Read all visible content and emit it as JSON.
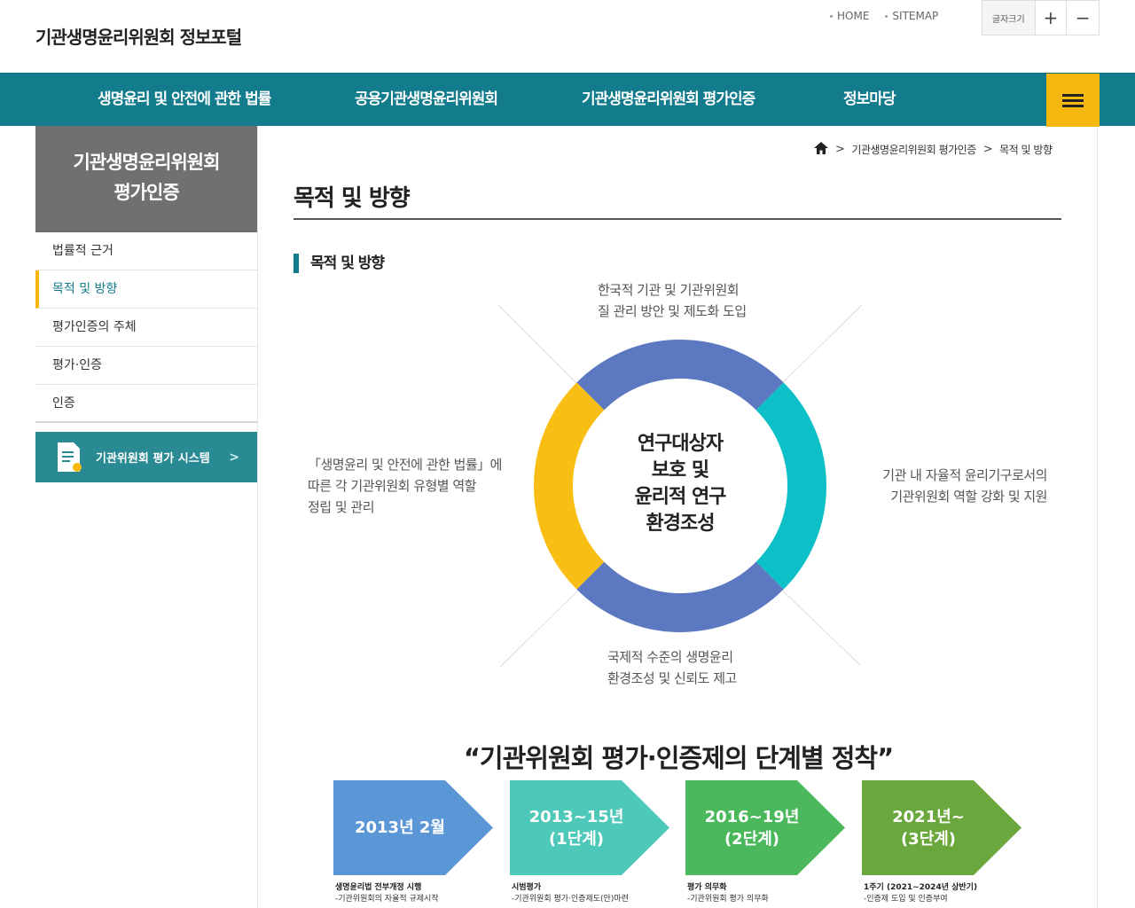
{
  "header": {
    "site_title": "기관생명윤리위원회 정보포털",
    "util_links": [
      "HOME",
      "SITEMAP"
    ],
    "font_size_label": "글자크기",
    "font_plus": "+",
    "font_minus": "−"
  },
  "gnb": {
    "items": [
      "생명윤리 및 안전에 관한 법률",
      "공용기관생명윤리위원회",
      "기관생명윤리위원회 평가인증",
      "정보마당"
    ],
    "menu_icon": "hamburger-icon"
  },
  "sidebar": {
    "title_line1": "기관생명윤리위원회",
    "title_line2": "평가인증",
    "items": [
      "법률적 근거",
      "목적 및 방향",
      "평가인증의 주체",
      "평가·인증",
      "인증"
    ],
    "active_index": 1,
    "system_link": "기관위원회 평가 시스템",
    "system_chevron": ">"
  },
  "breadcrumb": {
    "home_icon": "home-icon",
    "items": [
      "기관생명윤리위원회 평가인증",
      "목적 및 방향"
    ]
  },
  "page": {
    "title": "목적 및 방향",
    "section_title": "목적 및 방향"
  },
  "diagram": {
    "top_line1": "한국적 기관 및 기관위원회",
    "top_line2": "질 관리 방안 및 제도화 도입",
    "left_line1": "「생명윤리 및 안전에 관한 법률」에",
    "left_line2": "따른 각 기관위원회 유형별 역할",
    "left_line3": "정립 및 관리",
    "right_line1": "기관 내 자율적 윤리기구로서의",
    "right_line2": "기관위원회 역할 강화 및 지원",
    "bottom_line1": "국제적 수준의 생명윤리",
    "bottom_line2": "환경조성 및 신뢰도 제고",
    "center_line1": "연구대상자",
    "center_line2": "보호 및",
    "center_line3": "윤리적 연구",
    "center_line4": "환경조성",
    "colors": {
      "blue": "#5b78c1",
      "teal": "#0dbfc6",
      "yellow": "#f9be14"
    }
  },
  "stages": {
    "title": "“기관위원회 평가·인증제의 단계별 정착”",
    "items": [
      {
        "line1": "2013년 2월",
        "line2": "",
        "color": "#5b96d6",
        "desc_title": "생명윤리법 전부개정 시행",
        "desc": "-기관위원회의 자율적 규제시작"
      },
      {
        "line1": "2013~15년",
        "line2": "(1단계)",
        "color": "#4ec8b8",
        "desc_title": "시범평가",
        "desc": "-기관위원회 평가·인증제도(안)마련"
      },
      {
        "line1": "2016~19년",
        "line2": "(2단계)",
        "color": "#4cb85c",
        "desc_title": "평가 의무화",
        "desc": "-기관위원회 평가 의무화"
      },
      {
        "line1": "2021년~",
        "line2": "(3단계)",
        "color": "#6aa83e",
        "desc_title": "1주기 (2021~2024년 상반기)",
        "desc": "-인증제 도입 및 인증부여"
      }
    ]
  }
}
